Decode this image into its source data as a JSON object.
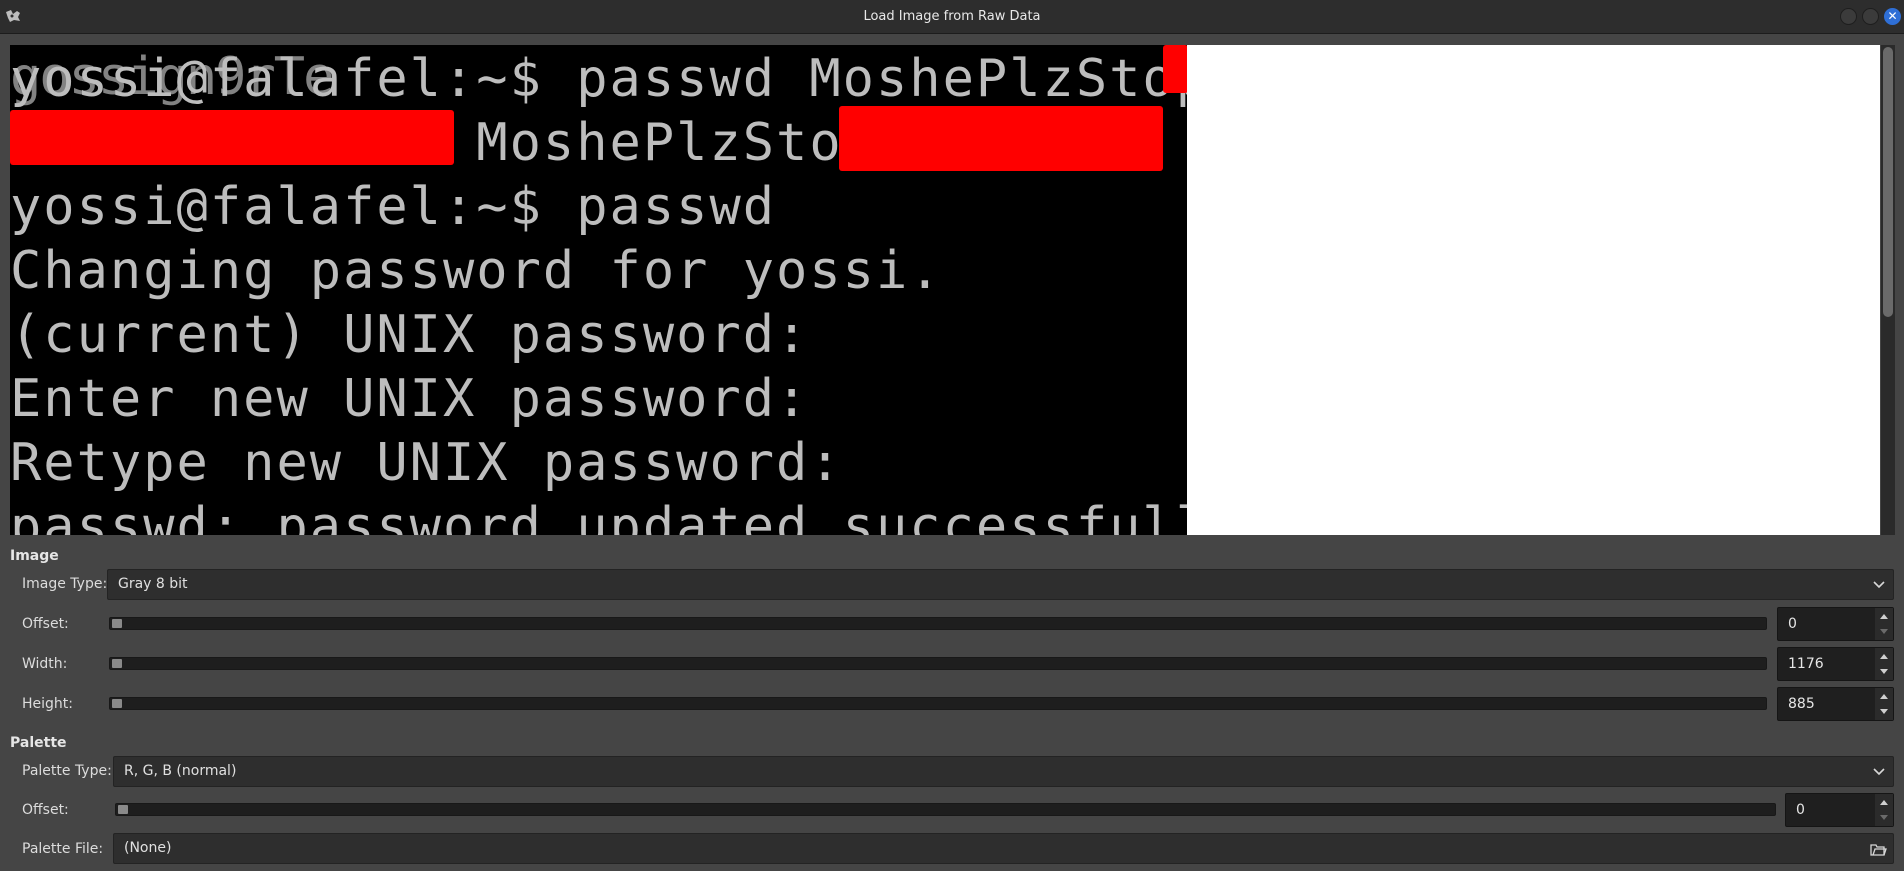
{
  "window": {
    "title": "Load Image from Raw Data",
    "close_glyph": "✕"
  },
  "terminal": {
    "lines": [
      "yossi@falafel:~$ passwd MoshePlzStop",
      "              MoshePlzStop          '",
      "yossi@falafel:~$ passwd",
      "Changing password for yossi.",
      "(current) UNIX password:",
      "Enter new UNIX password:",
      "Retype new UNIX password:",
      "passwd: password updated successfully"
    ]
  },
  "image_section": {
    "title": "Image",
    "image_type_label": "Image Type:",
    "image_type_value": "Gray 8 bit",
    "offset_label": "Offset:",
    "offset_value": "0",
    "width_label": "Width:",
    "width_value": "1176",
    "height_label": "Height:",
    "height_value": "885"
  },
  "palette_section": {
    "title": "Palette",
    "palette_type_label": "Palette Type:",
    "palette_type_value": "R, G, B (normal)",
    "offset_label": "Offset:",
    "offset_value": "0",
    "palette_file_label": "Palette File:",
    "palette_file_value": "(None)"
  },
  "icons": {
    "app": "gimp-icon",
    "dropdown": "chevron-down-icon",
    "file": "folder-open-icon"
  },
  "colors": {
    "accent": "#2f6fd6",
    "redaction": "#ff0000",
    "panel": "#454545"
  }
}
